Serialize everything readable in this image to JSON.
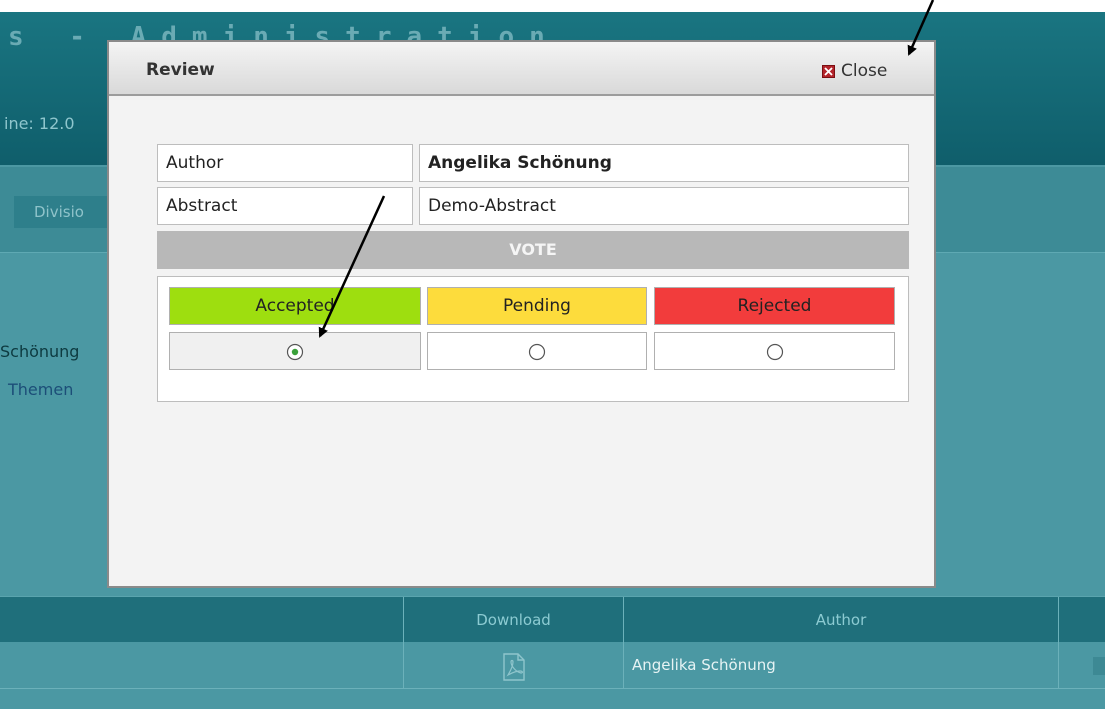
{
  "app": {
    "title": "s - Administration",
    "deadline_fragment": "ine: 12.0",
    "nav_tab_division": "Divisio",
    "content_author_fragment": "Schönung",
    "content_link_fragment": "Themen"
  },
  "table": {
    "headers": [
      "",
      "Download",
      "Author",
      ""
    ],
    "rows": [
      {
        "name": "",
        "download_icon": "pdf-icon",
        "author": "Angelika Schönung"
      }
    ]
  },
  "modal": {
    "title": "Review",
    "close_label": "Close",
    "close_icon": "close-icon",
    "author_label": "Author",
    "author_value": "Angelika Schönung",
    "abstract_label": "Abstract",
    "abstract_value": "Demo-Abstract",
    "vote_label": "VOTE",
    "vote_options": [
      {
        "label": "Accepted",
        "color": "#9ede0f",
        "selected": true
      },
      {
        "label": "Pending",
        "color": "#fddc3c",
        "selected": false
      },
      {
        "label": "Rejected",
        "color": "#f23c3c",
        "selected": false
      }
    ]
  },
  "colors": {
    "teal_background": "#4b98a3",
    "header_teal": "#0f5e6b",
    "modal_background": "#f3f3f3",
    "close_red": "#b3242b"
  }
}
